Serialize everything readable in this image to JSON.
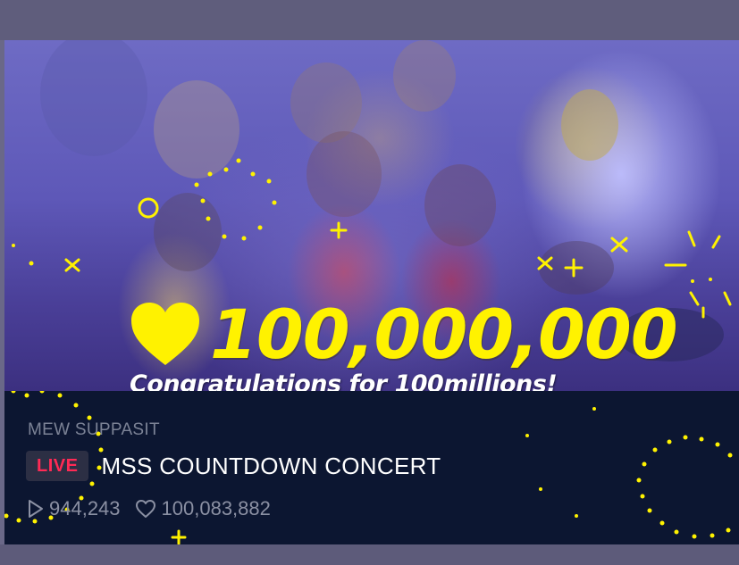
{
  "video": {
    "like_count_banner": "100,000,000",
    "congrats_text": "Congratulations for 100millions!"
  },
  "stream": {
    "channel": "MEW SUPPASIT",
    "live_label": "LIVE",
    "title": "MSS COUNTDOWN CONCERT",
    "views": "944,243",
    "likes": "100,083,882"
  },
  "colors": {
    "highlight": "#fff200",
    "live": "#ff2a55",
    "panel": "#0c1631"
  },
  "icons": [
    "heart-icon",
    "play-icon",
    "heart-outline-icon"
  ]
}
